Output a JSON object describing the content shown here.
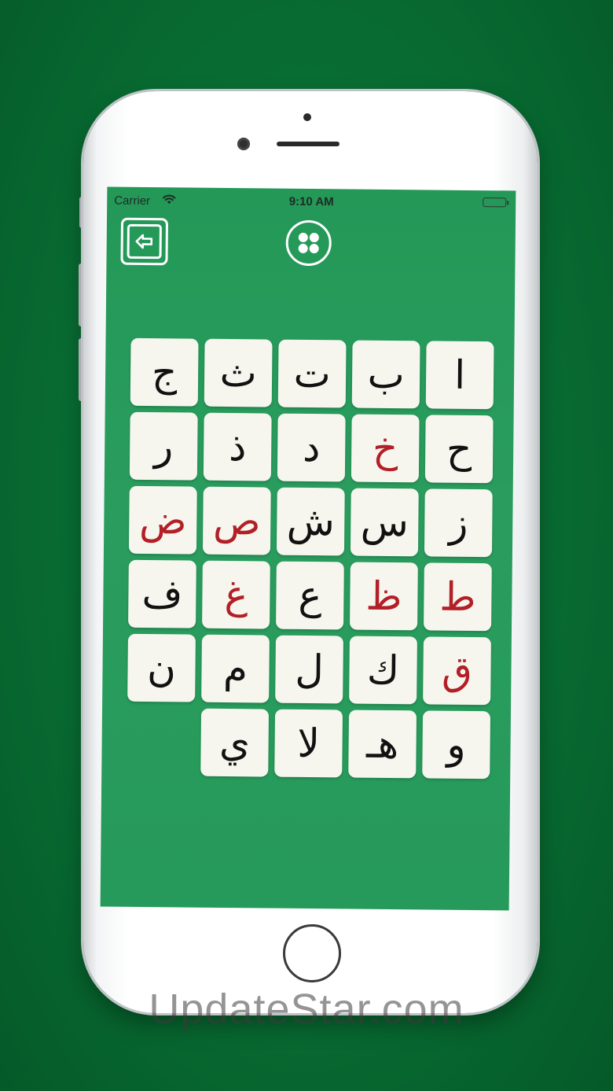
{
  "status_bar": {
    "carrier": "Carrier",
    "time": "9:10 AM"
  },
  "toolbar": {
    "back_icon": "back-arrow-icon",
    "menu_icon": "four-dots-icon"
  },
  "letters": [
    {
      "char": "ا",
      "highlight": false
    },
    {
      "char": "ب",
      "highlight": false
    },
    {
      "char": "ت",
      "highlight": false
    },
    {
      "char": "ث",
      "highlight": false
    },
    {
      "char": "ج",
      "highlight": false
    },
    {
      "char": "ح",
      "highlight": false
    },
    {
      "char": "خ",
      "highlight": true
    },
    {
      "char": "د",
      "highlight": false
    },
    {
      "char": "ذ",
      "highlight": false
    },
    {
      "char": "ر",
      "highlight": false
    },
    {
      "char": "ز",
      "highlight": false
    },
    {
      "char": "س",
      "highlight": false
    },
    {
      "char": "ش",
      "highlight": false
    },
    {
      "char": "ص",
      "highlight": true
    },
    {
      "char": "ض",
      "highlight": true
    },
    {
      "char": "ط",
      "highlight": true
    },
    {
      "char": "ظ",
      "highlight": true
    },
    {
      "char": "ع",
      "highlight": false
    },
    {
      "char": "غ",
      "highlight": true
    },
    {
      "char": "ف",
      "highlight": false
    },
    {
      "char": "ق",
      "highlight": true
    },
    {
      "char": "ك",
      "highlight": false
    },
    {
      "char": "ل",
      "highlight": false
    },
    {
      "char": "م",
      "highlight": false
    },
    {
      "char": "ن",
      "highlight": false
    },
    {
      "char": "و",
      "highlight": false
    },
    {
      "char": "هـ",
      "highlight": false
    },
    {
      "char": "لا",
      "highlight": false
    },
    {
      "char": "ي",
      "highlight": false
    }
  ],
  "colors": {
    "letter_normal": "#111111",
    "letter_highlight": "#b21f27",
    "screen_green": "#239857",
    "background_green": "#096d34"
  },
  "watermark": "UpdateStar.com"
}
